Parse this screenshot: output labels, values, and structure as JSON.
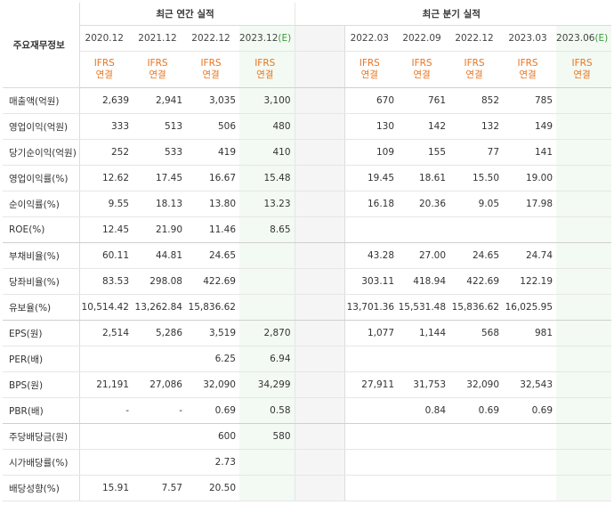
{
  "headers": {
    "corner": "주요재무정보",
    "annual_title": "최근 연간 실적",
    "quarter_title": "최근 분기 실적",
    "annual_periods": [
      "2020.12",
      "2021.12",
      "2022.12",
      "2023.12"
    ],
    "annual_est_mark": "(E)",
    "quarter_periods": [
      "2022.03",
      "2022.09",
      "2022.12",
      "2023.03",
      "2023.06"
    ],
    "quarter_est_mark": "(E)",
    "ifrs_line1": "IFRS",
    "ifrs_line2": "연결"
  },
  "rows": [
    {
      "label": "매출액(억원)",
      "annual": [
        "2,639",
        "2,941",
        "3,035",
        "3,100"
      ],
      "quarter": [
        "670",
        "761",
        "852",
        "785",
        ""
      ]
    },
    {
      "label": "영업이익(억원)",
      "annual": [
        "333",
        "513",
        "506",
        "480"
      ],
      "quarter": [
        "130",
        "142",
        "132",
        "149",
        ""
      ]
    },
    {
      "label": "당기순이익(억원)",
      "annual": [
        "252",
        "533",
        "419",
        "410"
      ],
      "quarter": [
        "109",
        "155",
        "77",
        "141",
        ""
      ]
    },
    {
      "label": "영업이익률(%)",
      "annual": [
        "12.62",
        "17.45",
        "16.67",
        "15.48"
      ],
      "quarter": [
        "19.45",
        "18.61",
        "15.50",
        "19.00",
        ""
      ]
    },
    {
      "label": "순이익률(%)",
      "annual": [
        "9.55",
        "18.13",
        "13.80",
        "13.23"
      ],
      "quarter": [
        "16.18",
        "20.36",
        "9.05",
        "17.98",
        ""
      ]
    },
    {
      "label": "ROE(%)",
      "annual": [
        "12.45",
        "21.90",
        "11.46",
        "8.65"
      ],
      "quarter": [
        "",
        "",
        "",
        "",
        ""
      ]
    },
    {
      "label": "부채비율(%)",
      "annual": [
        "60.11",
        "44.81",
        "24.65",
        ""
      ],
      "quarter": [
        "43.28",
        "27.00",
        "24.65",
        "24.74",
        ""
      ]
    },
    {
      "label": "당좌비율(%)",
      "annual": [
        "83.53",
        "298.08",
        "422.69",
        ""
      ],
      "quarter": [
        "303.11",
        "418.94",
        "422.69",
        "122.19",
        ""
      ]
    },
    {
      "label": "유보율(%)",
      "annual": [
        "10,514.42",
        "13,262.84",
        "15,836.62",
        ""
      ],
      "quarter": [
        "13,701.36",
        "15,531.48",
        "15,836.62",
        "16,025.95",
        ""
      ]
    },
    {
      "label": "EPS(원)",
      "annual": [
        "2,514",
        "5,286",
        "3,519",
        "2,870"
      ],
      "quarter": [
        "1,077",
        "1,144",
        "568",
        "981",
        ""
      ]
    },
    {
      "label": "PER(배)",
      "annual": [
        "",
        "",
        "6.25",
        "6.94"
      ],
      "quarter": [
        "",
        "",
        "",
        "",
        ""
      ]
    },
    {
      "label": "BPS(원)",
      "annual": [
        "21,191",
        "27,086",
        "32,090",
        "34,299"
      ],
      "quarter": [
        "27,911",
        "31,753",
        "32,090",
        "32,543",
        ""
      ]
    },
    {
      "label": "PBR(배)",
      "annual": [
        "-",
        "-",
        "0.69",
        "0.58"
      ],
      "quarter": [
        "",
        "0.84",
        "0.69",
        "0.69",
        ""
      ]
    },
    {
      "label": "주당배당금(원)",
      "annual": [
        "",
        "",
        "600",
        "580"
      ],
      "quarter": [
        "",
        "",
        "",
        "",
        ""
      ]
    },
    {
      "label": "시가배당률(%)",
      "annual": [
        "",
        "",
        "2.73",
        ""
      ],
      "quarter": [
        "",
        "",
        "",
        "",
        ""
      ]
    },
    {
      "label": "배당성향(%)",
      "annual": [
        "15.91",
        "7.57",
        "20.50",
        ""
      ],
      "quarter": [
        "",
        "",
        "",
        "",
        ""
      ]
    }
  ],
  "group_breaks_after": [
    5,
    8,
    12
  ],
  "colors": {
    "ifrs": "#e9741e",
    "estimate_bg": "#f3faf3",
    "estimate_text": "#3c9a3c"
  }
}
